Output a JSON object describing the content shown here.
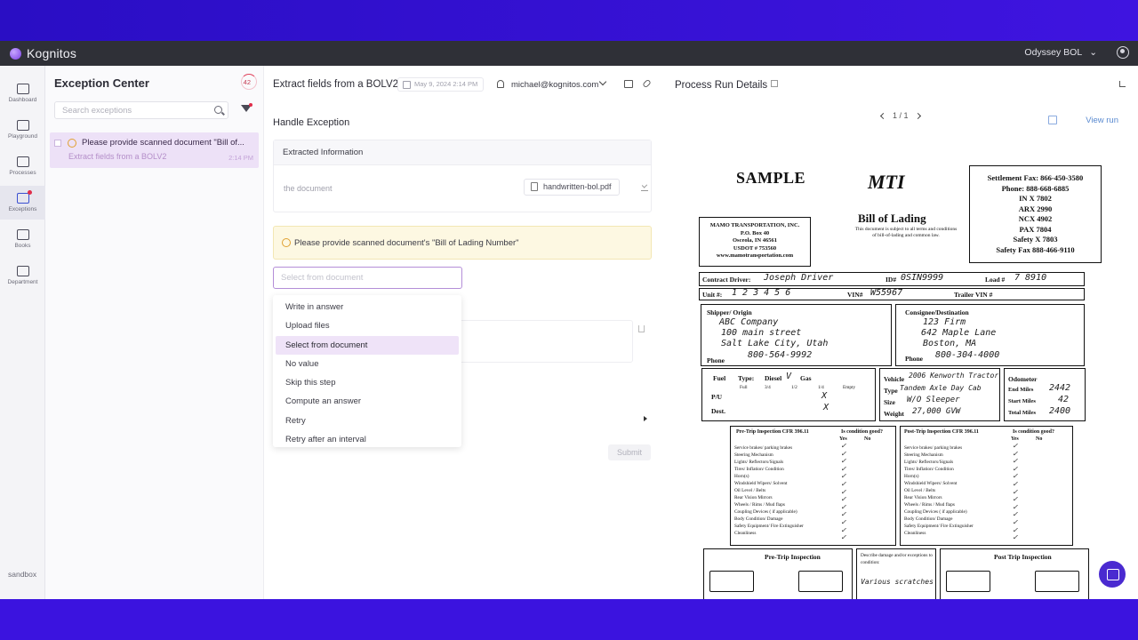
{
  "app": {
    "name": "Kognitos",
    "workspace": "Odyssey BOL"
  },
  "nav": [
    {
      "label": "Dashboard"
    },
    {
      "label": "Playground"
    },
    {
      "label": "Processes"
    },
    {
      "label": "Exceptions"
    },
    {
      "label": "Books"
    },
    {
      "label": "Department"
    }
  ],
  "env_label": "sandbox",
  "exceptions": {
    "title": "Exception Center",
    "count": "42",
    "search_placeholder": "Search exceptions",
    "item": {
      "title": "Please provide scanned document \"Bill of...",
      "subtitle": "Extract fields from a BOLV2",
      "time": "2:14 PM"
    }
  },
  "run": {
    "title": "Extract fields from a BOLV2",
    "date": "May 9, 2024 2:14 PM",
    "user": "michael@kognitos.com",
    "handle_title": "Handle Exception",
    "extracted_header": "Extracted Information",
    "field_label": "the document",
    "file_name": "handwritten-bol.pdf",
    "alert": "Please provide scanned document's \"Bill of Lading Number\"",
    "select_placeholder": "Select from document",
    "menu": [
      "Write in answer",
      "Upload files",
      "Select from document",
      "No value",
      "Skip this step",
      "Compute an answer",
      "Retry",
      "Retry after an interval"
    ],
    "selected_index": 2,
    "submit": "Submit"
  },
  "details": {
    "title": "Process Run Details",
    "page": "1 / 1",
    "view_run": "View run"
  },
  "document": {
    "sample": "SAMPLE",
    "logo_text": "MTI",
    "logo_sub": "MAMO",
    "title": "Bill of Lading",
    "subtitle": "This document is subject to all terms and conditions of bill-of-lading and common law.",
    "company": [
      "MAMO TRANSPORTATION, INC.",
      "P.O. Box 40",
      "Osceola, IN 46561",
      "USDOT # 753560",
      "www.mamotransportation.com"
    ],
    "fax": [
      "Settlement Fax: 866-450-3580",
      "Phone: 888-668-6885",
      "IN X 7802",
      "ARX 2990",
      "NCX 4902",
      "PAX 7804",
      "Safety X 7803",
      "Safety Fax 888-466-9110"
    ],
    "contract_driver_label": "Contract Driver:",
    "contract_driver": "Joseph Driver",
    "id_label": "ID#",
    "id": "0SIN9999",
    "load_label": "Load #",
    "load": "7 8910",
    "unit_label": "Unit #:",
    "unit": "1 2 3 4 5 6",
    "vin_label": "VIN#",
    "vin": "W55967",
    "trailer_label": "Trailer VIN #",
    "shipper_label": "Shipper/ Origin",
    "shipper": [
      "ABC Company",
      "100 main street",
      "Salt Lake City, Utah",
      "800-564-9992"
    ],
    "consignee_label": "Consignee/Destination",
    "consignee": [
      "123 Firm",
      "642 Maple Lane",
      "Boston, MA",
      "800-304-4000"
    ],
    "phone_label": "Phone",
    "fuel_label": "Fuel",
    "type_label": "Type:",
    "diesel_label": "Diesel",
    "gas_label": "Gas",
    "fuel_cols": [
      "Full",
      "3/4",
      "1/2",
      "1/4",
      "Empty"
    ],
    "pu_label": "P/U",
    "dest_label": "Dest.",
    "vehicle_label": "Vehicle",
    "vehicle": "2006 Kenworth Tractor",
    "vehicle_type_label": "Type",
    "vehicle_type": "Tandem Axle Day Cab",
    "size_label": "Size",
    "size": "W/O Sleeper",
    "weight_label": "Weight",
    "weight": "27,000 GVW",
    "odometer_label": "Odometer",
    "end_miles_label": "End Miles",
    "end_miles": "2442",
    "start_miles_label": "Start Miles",
    "start_miles": "42",
    "total_miles_label": "Total Miles",
    "total_miles": "2400",
    "pre_title": "Pre-Trip Inspection CFR 396.11",
    "post_title": "Post-Trip Inspection CFR 396.11",
    "condition_label": "Is condition good?",
    "yes_label": "Yes",
    "no_label": "No",
    "checklist": [
      "Service brakes/ parking brakes",
      "Steering Mechanism",
      "Lights/ Reflectors/Signals",
      "Tires/ Inflation/ Condition",
      "Horn(s)",
      "Windshield Wipers/ Solvent",
      "Oil Level / Belts",
      "Rear Vision Mirrors",
      "Wheels / Rims / Mud flaps",
      "Coupling Devices ( if applicable)",
      "Body Condition/ Damage",
      "Safety Equipment/ Fire Extinguisher",
      "Cleanliness"
    ],
    "pre_trip_label": "Pre-Trip Inspection",
    "post_trip_label": "Post Trip Inspection",
    "describe_label": "Describe damage and/or exceptions to condition:",
    "describe_value": "Various scratches"
  }
}
